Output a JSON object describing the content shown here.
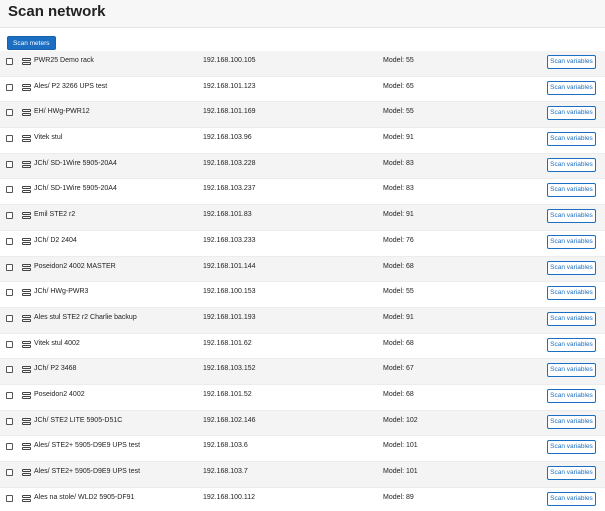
{
  "header": {
    "title": "Scan network"
  },
  "toolbar": {
    "scan_meters_label": "Scan meters"
  },
  "row_action_label": "Scan variables",
  "devices": [
    {
      "name": "PWR25 Demo rack",
      "ip": "192.168.100.105",
      "model": "Model: 55"
    },
    {
      "name": "Ales/ P2 3266 UPS test",
      "ip": "192.168.101.123",
      "model": "Model: 65"
    },
    {
      "name": "EH/ HWg-PWR12",
      "ip": "192.168.101.169",
      "model": "Model: 55"
    },
    {
      "name": "Vitek stul",
      "ip": "192.168.103.96",
      "model": "Model: 91"
    },
    {
      "name": "JCh/ SD-1Wire 5905-20A4",
      "ip": "192.168.103.228",
      "model": "Model: 83"
    },
    {
      "name": "JCh/ SD-1Wire 5905-20A4",
      "ip": "192.168.103.237",
      "model": "Model: 83"
    },
    {
      "name": "Emil STE2 r2",
      "ip": "192.168.101.83",
      "model": "Model: 91"
    },
    {
      "name": "JCh/ D2 2404",
      "ip": "192.168.103.233",
      "model": "Model: 76"
    },
    {
      "name": "Poseidon2 4002 MASTER",
      "ip": "192.168.101.144",
      "model": "Model: 68"
    },
    {
      "name": "JCh/ HWg-PWR3",
      "ip": "192.168.100.153",
      "model": "Model: 55"
    },
    {
      "name": "Ales stul STE2 r2 Charlie backup",
      "ip": "192.168.101.193",
      "model": "Model: 91"
    },
    {
      "name": "Vitek stul 4002",
      "ip": "192.168.101.62",
      "model": "Model: 68"
    },
    {
      "name": "JCh/ P2 3468",
      "ip": "192.168.103.152",
      "model": "Model: 67"
    },
    {
      "name": "Poseidon2 4002",
      "ip": "192.168.101.52",
      "model": "Model: 68"
    },
    {
      "name": "JCh/ STE2 LITE 5905-D51C",
      "ip": "192.168.102.146",
      "model": "Model: 102"
    },
    {
      "name": "Ales/ STE2+ 5905-D9E9 UPS test",
      "ip": "192.168.103.6",
      "model": "Model: 101"
    },
    {
      "name": "Ales/ STE2+ 5905-D9E9 UPS test",
      "ip": "192.168.103.7",
      "model": "Model: 101"
    },
    {
      "name": "Ales na stole/ WLD2 5905-DF91",
      "ip": "192.168.100.112",
      "model": "Model: 89"
    }
  ]
}
